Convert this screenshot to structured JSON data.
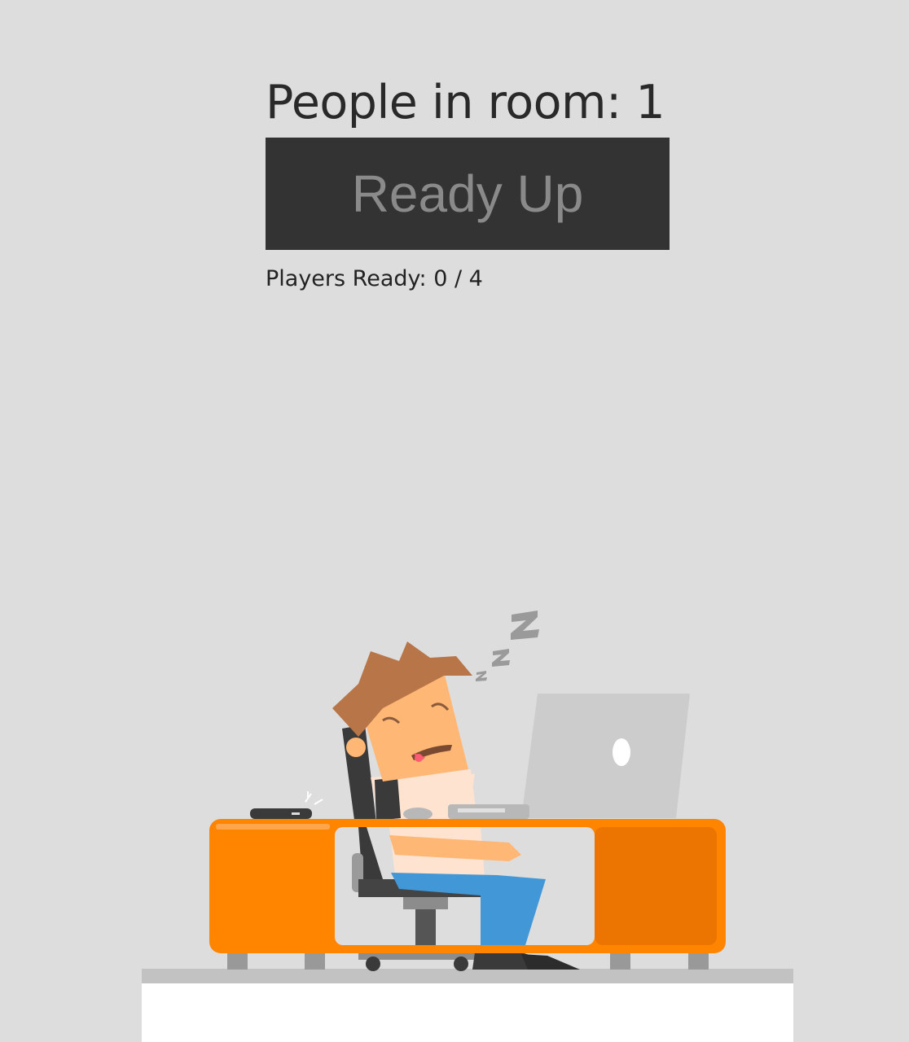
{
  "room": {
    "people_label": "People in room: 1"
  },
  "ready_button": {
    "label": "Ready Up"
  },
  "status": {
    "players_ready": "Players Ready: 0 / 4"
  },
  "illustration": {
    "subject": "sleeping-developer-at-desk",
    "colors": {
      "background": "#dddddd",
      "desk": "#ff8500",
      "desk_shade": "#ec7400",
      "laptop": "#cccccc",
      "floor": "#c2c2c2",
      "button": "#333333",
      "button_text": "#8a8a8a"
    }
  }
}
